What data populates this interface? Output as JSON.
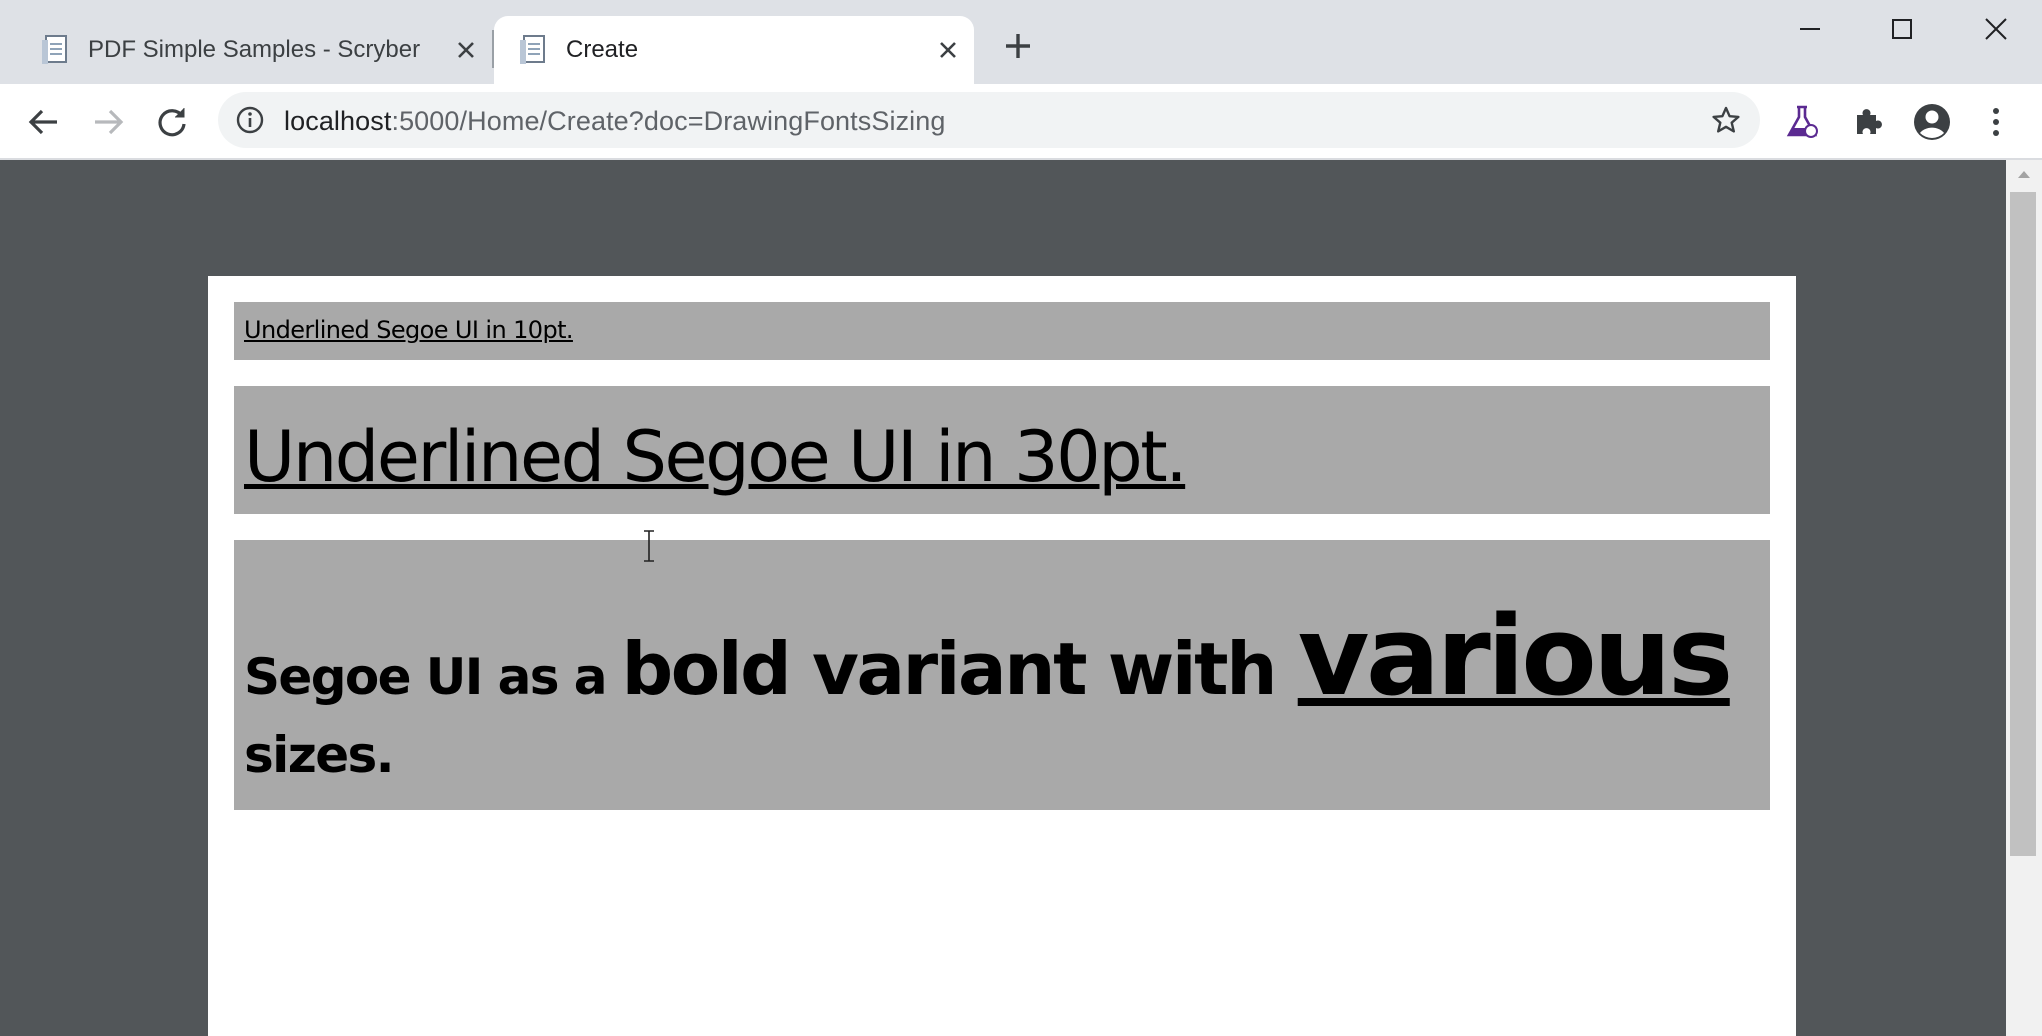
{
  "browser": {
    "tabs": [
      {
        "title": "PDF Simple Samples - Scryber",
        "active": false
      },
      {
        "title": "Create",
        "active": true
      }
    ],
    "new_tab_label": "+",
    "address": {
      "host": "localhost",
      "path": ":5000/Home/Create?doc=DrawingFontsSizing"
    },
    "colors": {
      "tabstrip": "#dee1e6",
      "omnibox": "#f1f3f4",
      "viewer_background": "#525659",
      "block_background": "#a9a9a9",
      "labs_icon": "#5b2a91"
    }
  },
  "document": {
    "block1": {
      "text": "Underlined Segoe UI in 10pt."
    },
    "block2": {
      "text": "Underlined Segoe UI in 30pt."
    },
    "block3": {
      "seg_small": "Segoe UI as a ",
      "seg_medium": "bold variant with ",
      "seg_large": "various",
      "seg_end": "sizes."
    }
  }
}
